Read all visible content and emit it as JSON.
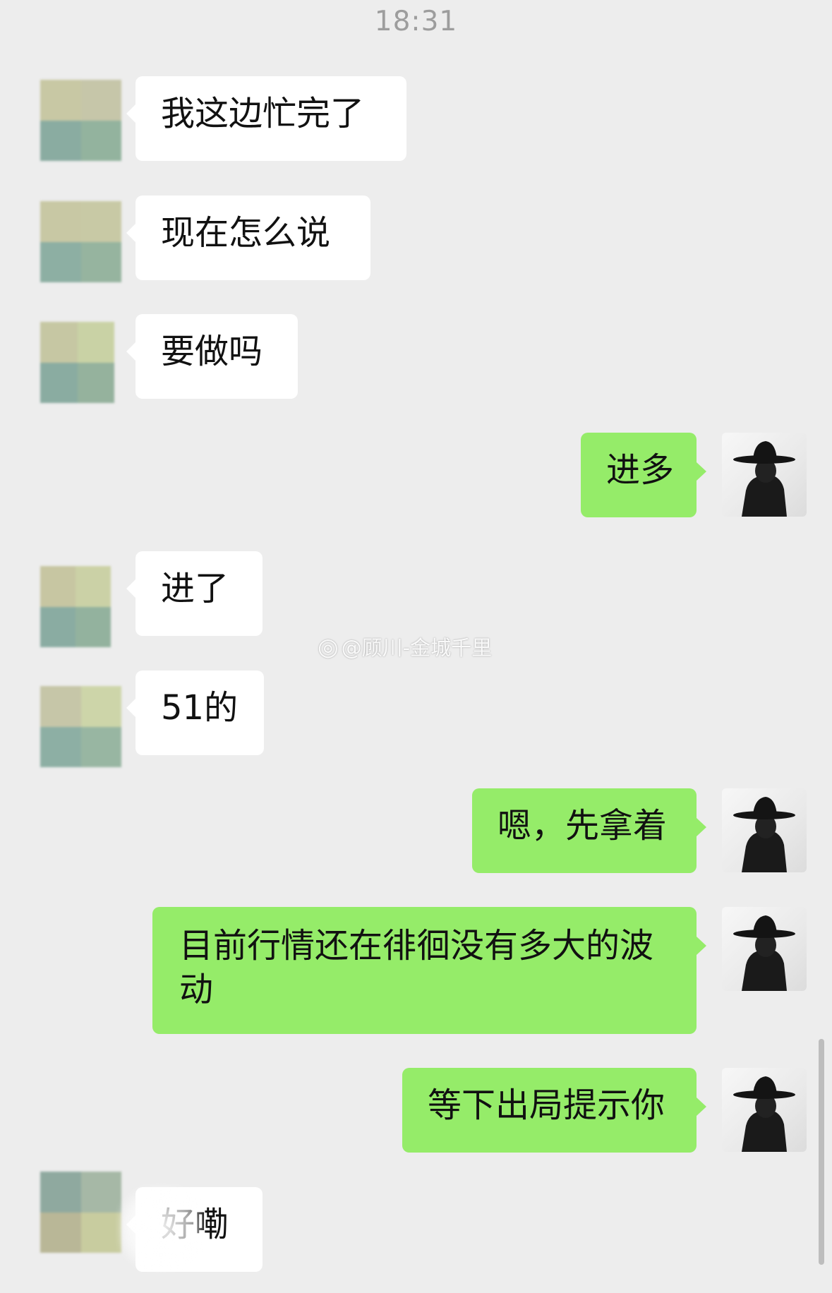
{
  "status": {
    "time": "18:31"
  },
  "colors": {
    "background": "#ededed",
    "incoming_bubble": "#ffffff",
    "outgoing_bubble": "#95ec69"
  },
  "messages": [
    {
      "side": "in",
      "text": "我这边忙完了"
    },
    {
      "side": "in",
      "text": "现在怎么说"
    },
    {
      "side": "in",
      "text": "要做吗"
    },
    {
      "side": "out",
      "text": "进多"
    },
    {
      "side": "in",
      "text": "进了"
    },
    {
      "side": "in",
      "text": "51的"
    },
    {
      "side": "out",
      "text": "嗯，先拿着"
    },
    {
      "side": "out",
      "text": "目前行情还在徘徊没有多大的波动"
    },
    {
      "side": "out",
      "text": "等下出局提示你"
    },
    {
      "side": "in",
      "text": "好嘞"
    }
  ],
  "watermark": {
    "icon": "weibo-icon",
    "text": "@顾川-金城千里"
  }
}
